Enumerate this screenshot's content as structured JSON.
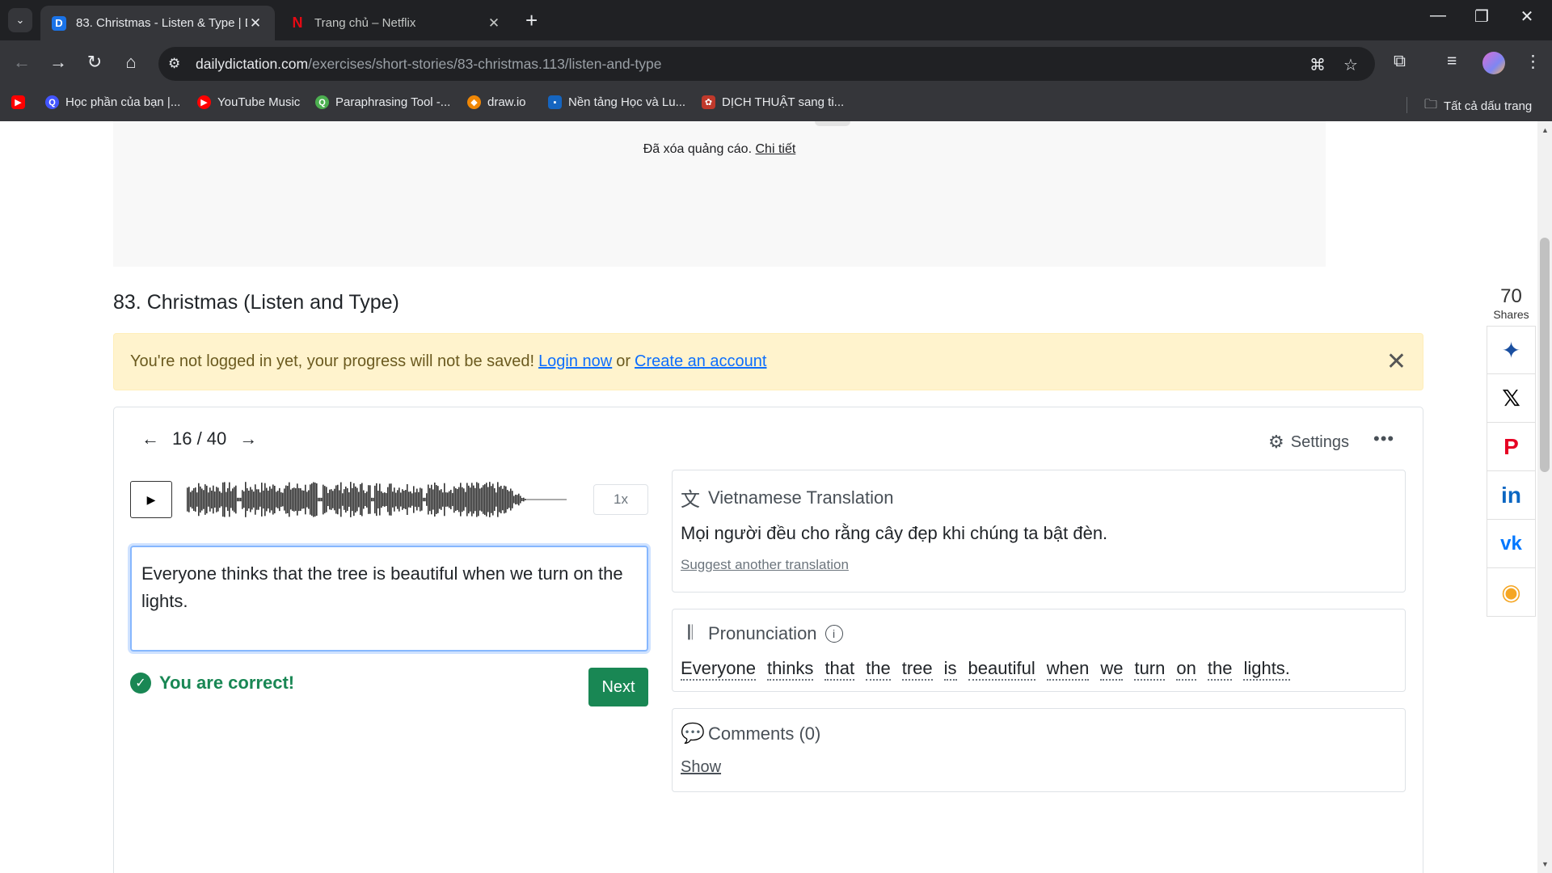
{
  "browser": {
    "tabs": [
      {
        "title": "83. Christmas - Listen & Type | Daily Dictation",
        "favicon": "D",
        "active": true
      },
      {
        "title": "Trang chủ – Netflix",
        "favicon": "N",
        "active": false
      }
    ],
    "url_host": "dailydictation.com",
    "url_path": "/exercises/short-stories/83-christmas.113/listen-and-type",
    "bookmarks": [
      {
        "label": "",
        "icon": "youtube-icon"
      },
      {
        "label": "Học phần của bạn |...",
        "icon": "quizlet-icon"
      },
      {
        "label": "YouTube Music",
        "icon": "youtube-music-icon"
      },
      {
        "label": "Paraphrasing Tool -...",
        "icon": "quillbot-icon"
      },
      {
        "label": "draw.io",
        "icon": "drawio-icon"
      },
      {
        "label": "Nền tảng Học và Lu...",
        "icon": "platform-icon"
      },
      {
        "label": "DỊCH THUẬT sang ti...",
        "icon": "translate-icon"
      }
    ],
    "all_bookmarks": "Tất cả dấu trang"
  },
  "ad": {
    "text": "Đã xóa quảng cáo.",
    "link": "Chi tiết"
  },
  "page": {
    "title": "83. Christmas (Listen and Type)",
    "alert": {
      "text": "You're not logged in yet, your progress will not be saved!",
      "login": "Login now",
      "or": "or",
      "create": "Create an account"
    },
    "pager": "16 / 40",
    "settings": "Settings",
    "speed": "1x",
    "answer": "Everyone thinks that the tree is beautiful when we turn on the lights.",
    "correct": "You are correct!",
    "next": "Next",
    "translation": {
      "heading": "Vietnamese Translation",
      "text": "Mọi người đều cho rằng cây đẹp khi chúng ta bật đèn.",
      "suggest": "Suggest another translation"
    },
    "pronunciation": {
      "heading": "Pronunciation",
      "words": [
        "Everyone",
        "thinks",
        "that",
        "the",
        "tree",
        "is",
        "beautiful",
        "when",
        "we",
        "turn",
        "on",
        "the",
        "lights."
      ]
    },
    "comments": {
      "heading": "Comments (0)",
      "show": "Show"
    }
  },
  "share": {
    "count": "70",
    "label": "Shares"
  },
  "colors": {
    "accent_green": "#198754",
    "alert_bg": "#fff3cd",
    "link_blue": "#0d6efd"
  }
}
